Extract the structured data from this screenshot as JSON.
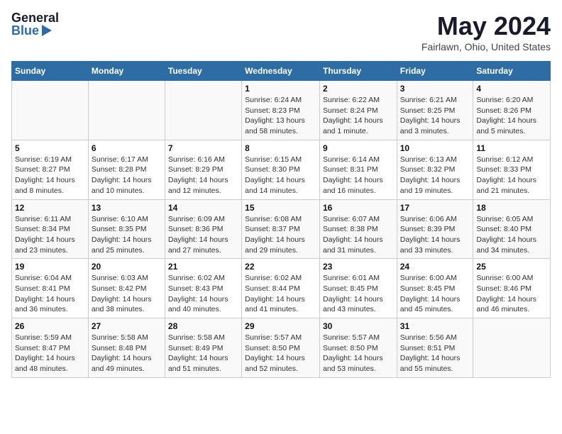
{
  "header": {
    "logo_general": "General",
    "logo_blue": "Blue",
    "title": "May 2024",
    "location": "Fairlawn, Ohio, United States"
  },
  "days_of_week": [
    "Sunday",
    "Monday",
    "Tuesday",
    "Wednesday",
    "Thursday",
    "Friday",
    "Saturday"
  ],
  "weeks": [
    [
      {
        "num": "",
        "info": ""
      },
      {
        "num": "",
        "info": ""
      },
      {
        "num": "",
        "info": ""
      },
      {
        "num": "1",
        "info": "Sunrise: 6:24 AM\nSunset: 8:23 PM\nDaylight: 13 hours and 58 minutes."
      },
      {
        "num": "2",
        "info": "Sunrise: 6:22 AM\nSunset: 8:24 PM\nDaylight: 14 hours and 1 minute."
      },
      {
        "num": "3",
        "info": "Sunrise: 6:21 AM\nSunset: 8:25 PM\nDaylight: 14 hours and 3 minutes."
      },
      {
        "num": "4",
        "info": "Sunrise: 6:20 AM\nSunset: 8:26 PM\nDaylight: 14 hours and 5 minutes."
      }
    ],
    [
      {
        "num": "5",
        "info": "Sunrise: 6:19 AM\nSunset: 8:27 PM\nDaylight: 14 hours and 8 minutes."
      },
      {
        "num": "6",
        "info": "Sunrise: 6:17 AM\nSunset: 8:28 PM\nDaylight: 14 hours and 10 minutes."
      },
      {
        "num": "7",
        "info": "Sunrise: 6:16 AM\nSunset: 8:29 PM\nDaylight: 14 hours and 12 minutes."
      },
      {
        "num": "8",
        "info": "Sunrise: 6:15 AM\nSunset: 8:30 PM\nDaylight: 14 hours and 14 minutes."
      },
      {
        "num": "9",
        "info": "Sunrise: 6:14 AM\nSunset: 8:31 PM\nDaylight: 14 hours and 16 minutes."
      },
      {
        "num": "10",
        "info": "Sunrise: 6:13 AM\nSunset: 8:32 PM\nDaylight: 14 hours and 19 minutes."
      },
      {
        "num": "11",
        "info": "Sunrise: 6:12 AM\nSunset: 8:33 PM\nDaylight: 14 hours and 21 minutes."
      }
    ],
    [
      {
        "num": "12",
        "info": "Sunrise: 6:11 AM\nSunset: 8:34 PM\nDaylight: 14 hours and 23 minutes."
      },
      {
        "num": "13",
        "info": "Sunrise: 6:10 AM\nSunset: 8:35 PM\nDaylight: 14 hours and 25 minutes."
      },
      {
        "num": "14",
        "info": "Sunrise: 6:09 AM\nSunset: 8:36 PM\nDaylight: 14 hours and 27 minutes."
      },
      {
        "num": "15",
        "info": "Sunrise: 6:08 AM\nSunset: 8:37 PM\nDaylight: 14 hours and 29 minutes."
      },
      {
        "num": "16",
        "info": "Sunrise: 6:07 AM\nSunset: 8:38 PM\nDaylight: 14 hours and 31 minutes."
      },
      {
        "num": "17",
        "info": "Sunrise: 6:06 AM\nSunset: 8:39 PM\nDaylight: 14 hours and 33 minutes."
      },
      {
        "num": "18",
        "info": "Sunrise: 6:05 AM\nSunset: 8:40 PM\nDaylight: 14 hours and 34 minutes."
      }
    ],
    [
      {
        "num": "19",
        "info": "Sunrise: 6:04 AM\nSunset: 8:41 PM\nDaylight: 14 hours and 36 minutes."
      },
      {
        "num": "20",
        "info": "Sunrise: 6:03 AM\nSunset: 8:42 PM\nDaylight: 14 hours and 38 minutes."
      },
      {
        "num": "21",
        "info": "Sunrise: 6:02 AM\nSunset: 8:43 PM\nDaylight: 14 hours and 40 minutes."
      },
      {
        "num": "22",
        "info": "Sunrise: 6:02 AM\nSunset: 8:44 PM\nDaylight: 14 hours and 41 minutes."
      },
      {
        "num": "23",
        "info": "Sunrise: 6:01 AM\nSunset: 8:45 PM\nDaylight: 14 hours and 43 minutes."
      },
      {
        "num": "24",
        "info": "Sunrise: 6:00 AM\nSunset: 8:45 PM\nDaylight: 14 hours and 45 minutes."
      },
      {
        "num": "25",
        "info": "Sunrise: 6:00 AM\nSunset: 8:46 PM\nDaylight: 14 hours and 46 minutes."
      }
    ],
    [
      {
        "num": "26",
        "info": "Sunrise: 5:59 AM\nSunset: 8:47 PM\nDaylight: 14 hours and 48 minutes."
      },
      {
        "num": "27",
        "info": "Sunrise: 5:58 AM\nSunset: 8:48 PM\nDaylight: 14 hours and 49 minutes."
      },
      {
        "num": "28",
        "info": "Sunrise: 5:58 AM\nSunset: 8:49 PM\nDaylight: 14 hours and 51 minutes."
      },
      {
        "num": "29",
        "info": "Sunrise: 5:57 AM\nSunset: 8:50 PM\nDaylight: 14 hours and 52 minutes."
      },
      {
        "num": "30",
        "info": "Sunrise: 5:57 AM\nSunset: 8:50 PM\nDaylight: 14 hours and 53 minutes."
      },
      {
        "num": "31",
        "info": "Sunrise: 5:56 AM\nSunset: 8:51 PM\nDaylight: 14 hours and 55 minutes."
      },
      {
        "num": "",
        "info": ""
      }
    ]
  ]
}
